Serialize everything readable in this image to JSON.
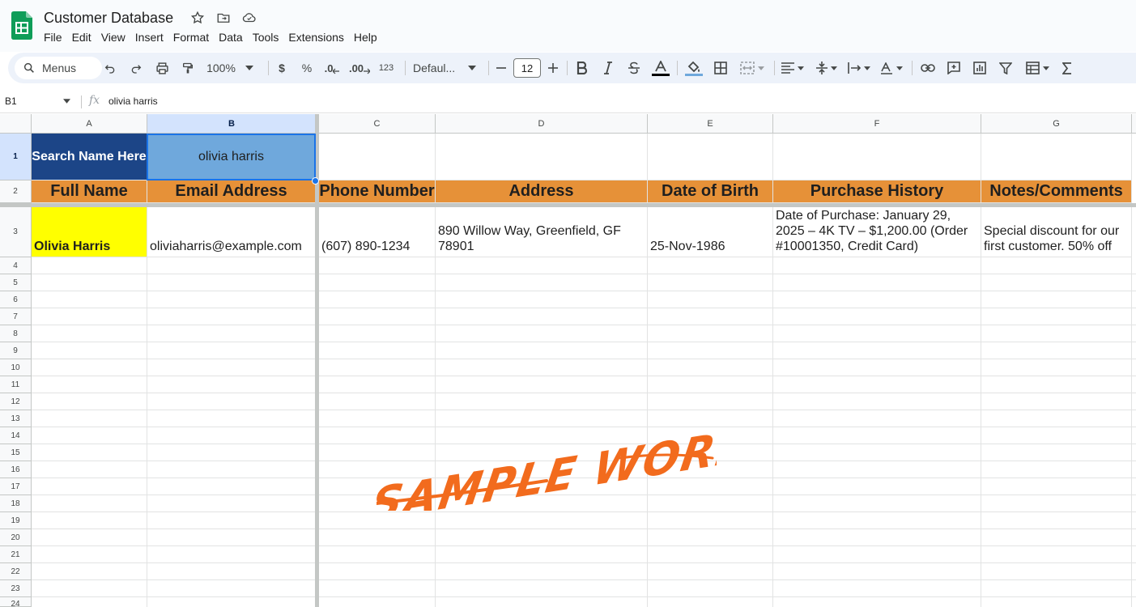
{
  "app": {
    "doc_title": "Customer Database",
    "brand_color": "#0f9d58"
  },
  "menubar": [
    "File",
    "Edit",
    "View",
    "Insert",
    "Format",
    "Data",
    "Tools",
    "Extensions",
    "Help"
  ],
  "toolbar": {
    "menus_label": "Menus",
    "zoom": "100%",
    "currency": "$",
    "percent": "%",
    "dec_decrease": ".0",
    "dec_increase": ".00",
    "number_format": "123",
    "font": "Defaul...",
    "font_size": "12"
  },
  "formula_bar": {
    "name_box": "B1",
    "fx": "fx",
    "formula": "olivia harris"
  },
  "sheet": {
    "columns": [
      "A",
      "B",
      "C",
      "D",
      "E",
      "F",
      "G"
    ],
    "rows": [
      "1",
      "2",
      "3",
      "4",
      "5",
      "6",
      "7",
      "8",
      "9",
      "10",
      "11",
      "12",
      "13",
      "14",
      "15",
      "16",
      "17",
      "18",
      "19",
      "20",
      "21",
      "22",
      "23",
      "24"
    ],
    "search_label": "Search Name Here",
    "search_value": "olivia harris",
    "headers": [
      "Full Name",
      "Email Address",
      "Phone Number",
      "Address",
      "Date of Birth",
      "Purchase History",
      "Notes/Comments"
    ],
    "record": {
      "full_name": "Olivia Harris",
      "email": "oliviaharris@example.com",
      "phone": "(607) 890-1234",
      "address": "890 Willow Way, Greenfield, GF 78901",
      "dob": "25-Nov-1986",
      "purchase_history": "Date of Purchase: January 29, 2025 – 4K TV – $1,200.00 (Order #10001350, Credit Card)",
      "notes": "Special discount for our first customer. 50% off"
    },
    "colors": {
      "search_label_bg": "#1c4587",
      "search_value_bg": "#6fa8dc",
      "header_bg": "#e69138",
      "name_highlight": "#ffff00",
      "selection": "#1a73e8"
    }
  },
  "watermark": {
    "text": "SAMPLE WORK",
    "color": "#f26b1d"
  }
}
